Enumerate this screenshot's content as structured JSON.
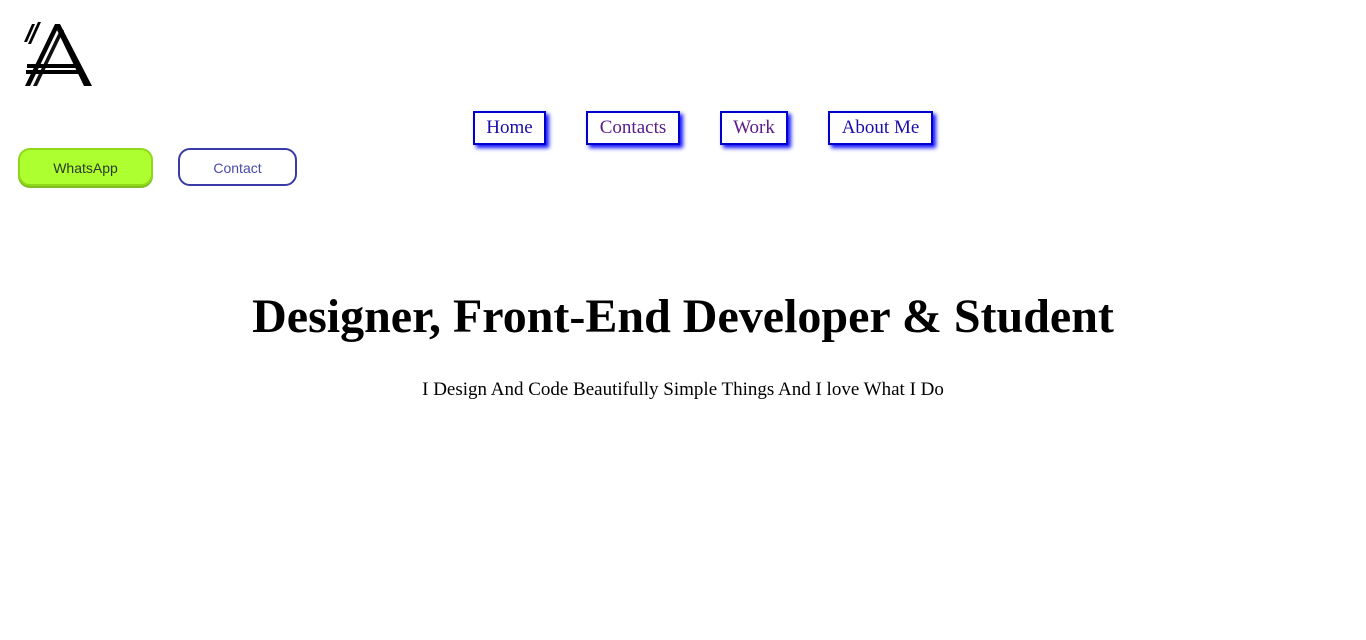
{
  "header": {
    "logo_icon": "letter-a-brush-logo-icon"
  },
  "nav": {
    "items": [
      {
        "label": "Home"
      },
      {
        "label": "Contacts"
      },
      {
        "label": "Work"
      },
      {
        "label": "About Me"
      }
    ]
  },
  "actions": {
    "whatsapp_label": "WhatsApp",
    "contact_label": "Contact"
  },
  "hero": {
    "headline": "Designer, Front-End Developer & Student",
    "tagline": "I Design And Code Beautifully Simple Things And I love What I Do"
  },
  "colors": {
    "nav_border": "#0000cc",
    "whatsapp_bg": "#adff2f",
    "contact_border": "#3a3aa8"
  }
}
